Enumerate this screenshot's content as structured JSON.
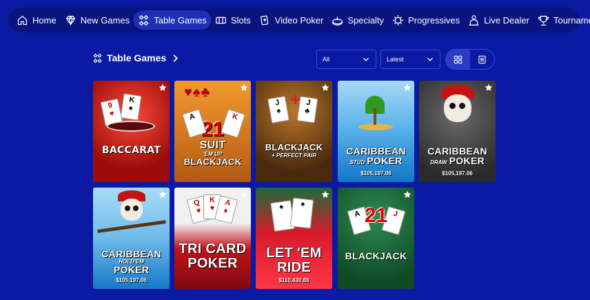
{
  "nav": {
    "items": [
      {
        "label": "Home",
        "icon": "home-icon"
      },
      {
        "label": "New Games",
        "icon": "diamond-icon"
      },
      {
        "label": "Table Games",
        "icon": "table-games-icon",
        "active": true
      },
      {
        "label": "Slots",
        "icon": "slots-icon"
      },
      {
        "label": "Video Poker",
        "icon": "video-poker-icon"
      },
      {
        "label": "Specialty",
        "icon": "specialty-icon"
      },
      {
        "label": "Progressives",
        "icon": "progressives-icon"
      },
      {
        "label": "Live Dealer",
        "icon": "live-dealer-icon"
      },
      {
        "label": "Tournaments",
        "icon": "trophy-icon"
      }
    ]
  },
  "section": {
    "title": "Table Games"
  },
  "filters": {
    "category": "All",
    "sort": "Latest"
  },
  "games": [
    {
      "title": "BACCARAT",
      "subtitle": "",
      "jackpot": ""
    },
    {
      "title": "SUIT 'EM UP BLACKJACK",
      "line1": "21",
      "line2": "SUIT",
      "line3": "'EM UP",
      "line4": "BLACKJACK",
      "jackpot": ""
    },
    {
      "title": "BLACKJACK",
      "subtitle": "+ PERFECT PAIR",
      "jackpot": ""
    },
    {
      "title": "CARIBBEAN",
      "sub": "STUD",
      "title2": "POKER",
      "jackpot": "$105,197.06"
    },
    {
      "title": "CARIBBEAN",
      "sub": "DRAW",
      "title2": "POKER",
      "jackpot": "$105,197.06"
    },
    {
      "title": "CARIBBEAN",
      "sub": "HOLD'EM",
      "title2": "POKER",
      "jackpot": "$105,197.06"
    },
    {
      "title": "TRI CARD",
      "title2": "POKER",
      "jackpot": ""
    },
    {
      "title": "LET 'EM",
      "title2": "RIDE",
      "jackpot": "$110,430.86"
    },
    {
      "title": "BLACKJACK",
      "badge": "21",
      "jackpot": ""
    }
  ],
  "colors": {
    "background": "#0a1aa3",
    "nav_bg": "#0a1480",
    "active_tab": "#1e2fb8"
  }
}
